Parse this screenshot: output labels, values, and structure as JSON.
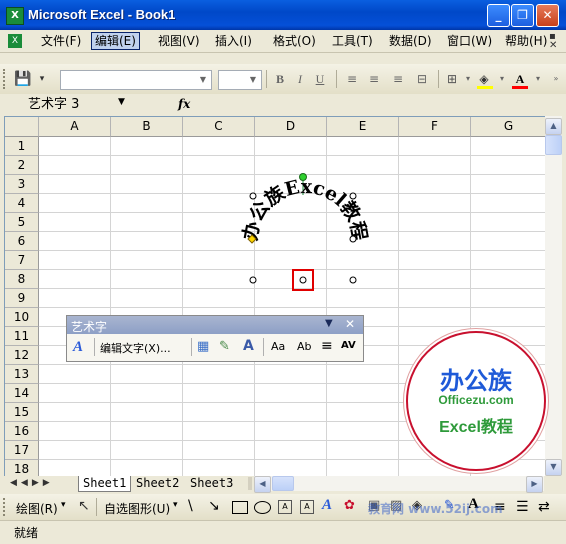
{
  "window": {
    "title": "Microsoft Excel - Book1",
    "app_icon": "X",
    "minimize": "_",
    "restore": "❐",
    "close": "✕"
  },
  "menubar": {
    "items": [
      "文件(F)",
      "编辑(E)",
      "视图(V)",
      "插入(I)",
      "格式(O)",
      "工具(T)",
      "数据(D)",
      "窗口(W)",
      "帮助(H)"
    ],
    "doc_min": "_",
    "doc_restore": "❐",
    "doc_close": "✕"
  },
  "formula": {
    "namebox": "艺术字 3",
    "fx": "fx"
  },
  "grid": {
    "columns": [
      "A",
      "B",
      "C",
      "D",
      "E",
      "F",
      "G"
    ],
    "rows": [
      "1",
      "2",
      "3",
      "4",
      "5",
      "6",
      "7",
      "8",
      "9",
      "10",
      "11",
      "12",
      "13",
      "14",
      "15",
      "16",
      "17",
      "18"
    ]
  },
  "wordart": {
    "text": "办公族Excel教程"
  },
  "wordart_toolbar": {
    "title": "艺术字",
    "edit_text": "编辑文字(X)...",
    "buttons": [
      "Aa",
      "Ab",
      "≡",
      "AV"
    ]
  },
  "sheets": {
    "tabs": [
      "Sheet1",
      "Sheet2",
      "Sheet3"
    ]
  },
  "drawbar": {
    "draw": "绘图(R)",
    "autoshapes": "自选图形(U)"
  },
  "status": {
    "text": "就绪"
  },
  "logo": {
    "line1": "办公族",
    "line2": "Officezu.com",
    "line3": "Excel教程"
  },
  "watermark": "教育网 www.52ij.com",
  "colors": {
    "title_blue": "#0550d8",
    "logo_red": "#c8102e",
    "logo_blue": "#1e5ad8",
    "logo_green": "#2e9a3a"
  }
}
